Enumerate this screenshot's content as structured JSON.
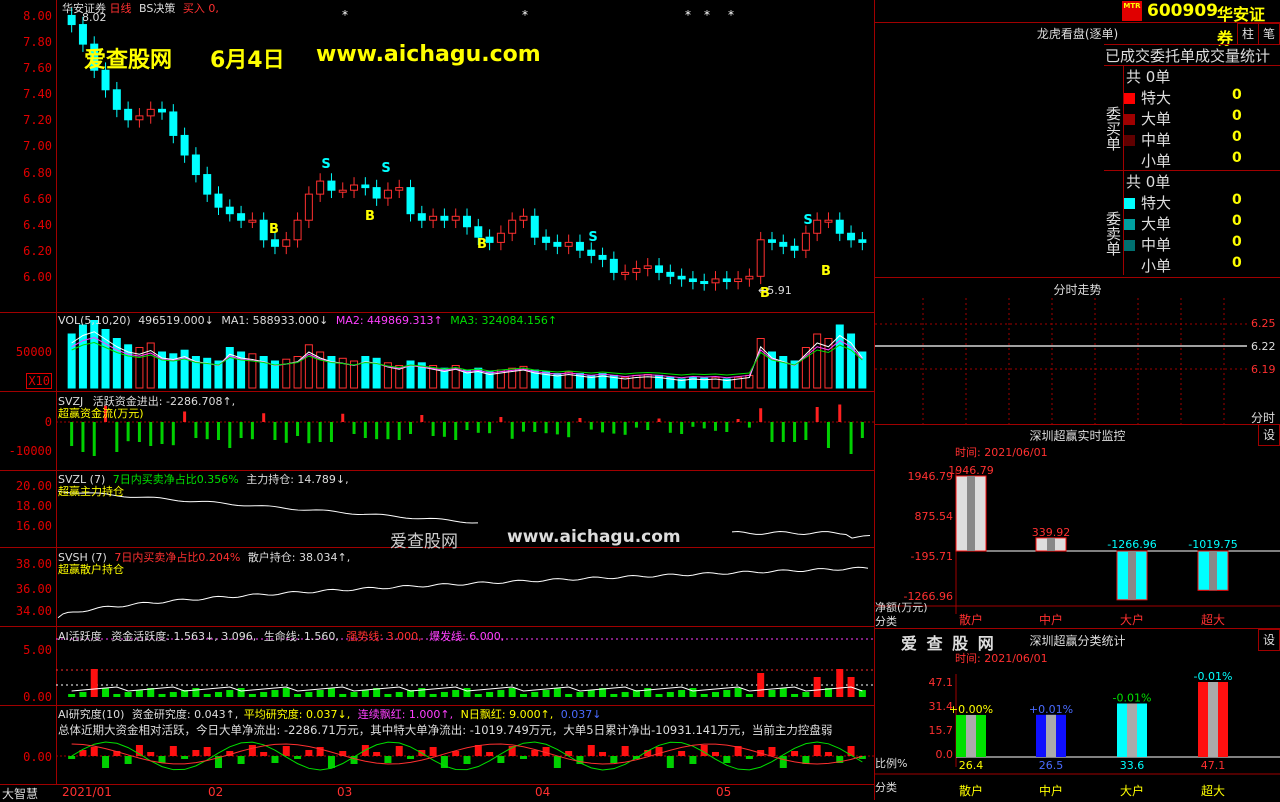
{
  "stock": {
    "code": "600909",
    "name": "华安证券",
    "badge": "MTR"
  },
  "chart_header": {
    "name": "华安证券",
    "period": "日线",
    "strategy": "BS决策",
    "buy": "买入",
    "buy_val": "0,"
  },
  "watermark1": {
    "site": "爱查股网",
    "date": "6月4日",
    "url": "www.aichagu.com"
  },
  "watermark2": {
    "site": "爱查股网",
    "url": "www.aichagu.com"
  },
  "price_axis": [
    "8.00",
    "7.80",
    "7.60",
    "7.40",
    "7.20",
    "7.00",
    "6.80",
    "6.60",
    "6.40",
    "6.20",
    "6.00"
  ],
  "price_labels": {
    "high": "8.02",
    "low": "5.91"
  },
  "vol": {
    "line": "VOL(5,10,20)",
    "v": "496519.000↓",
    "ma1": "MA1: 588933.000↓",
    "ma2": "MA2: 449869.313↑",
    "ma3": "MA3: 324084.156↑",
    "tick": "50000",
    "mult": "X10"
  },
  "svzj": {
    "name": "SVZJ",
    "label": "活跃资金进出: -2286.708↑,",
    "sub": "超赢资金流(万元)",
    "ticks": [
      "0",
      "-10000"
    ]
  },
  "svzl": {
    "name": "SVZL",
    "p": "(7)",
    "desc": "7日内买卖净占比0.356%",
    "hold": "主力持仓: 14.789↓,",
    "sub": "超赢主力持仓",
    "ticks": [
      "20.00",
      "18.00",
      "16.00"
    ]
  },
  "svsh": {
    "name": "SVSH",
    "p": "(7)",
    "desc": "7日内买卖净占比0.204%",
    "hold": "散户持仓: 38.034↑,",
    "sub": "超赢散户持仓",
    "ticks": [
      "38.00",
      "36.00",
      "34.00"
    ]
  },
  "ai_active": {
    "name": "AI活跃度",
    "a": "资金活跃度: 1.563↓,",
    "b": "3.096,",
    "c": "生命线: 1.560,",
    "d": "强势线: 3.000,",
    "e": "爆发线: 6.000,",
    "ticks": [
      "5.00",
      "0.00"
    ]
  },
  "ai_research": {
    "name": "AI研究度",
    "p": "(10)",
    "a": "资金研究度: 0.043↑,",
    "b": "平均研究度: 0.037↓,",
    "c": "连续飘红: 1.000↑,",
    "d": "N日飘红: 9.000↑,",
    "e": "0.037↓",
    "summary": "总体近期大资金相对活跃，今日大单净流出: -2286.71万元，其中特大单净流出: -1019.749万元，大单5日累计净出-10931.141万元，当前主力控盘弱",
    "tick": "0.00"
  },
  "xaxis": {
    "brand": "大智慧",
    "labels": [
      "2021/01",
      "02",
      "03",
      "04",
      "05"
    ]
  },
  "lhb": {
    "title": "龙虎看盘(逐单)",
    "btn1": "柱",
    "btn2": "笔",
    "sub": "已成交委托单成交量统计",
    "buy": {
      "side": "委买单",
      "total_label": "共",
      "total": "0单",
      "rows": [
        {
          "label": "特大",
          "val": "0",
          "color": "#ff0000"
        },
        {
          "label": "大单",
          "val": "0",
          "color": "#a00000"
        },
        {
          "label": "中单",
          "val": "0",
          "color": "#600000"
        },
        {
          "label": "小单",
          "val": "0",
          "color": "#000"
        }
      ]
    },
    "sell": {
      "side": "委卖单",
      "total_label": "共",
      "total": "0单",
      "rows": [
        {
          "label": "特大",
          "val": "0",
          "color": "#00ffff"
        },
        {
          "label": "大单",
          "val": "0",
          "color": "#00a0a0"
        },
        {
          "label": "中单",
          "val": "0",
          "color": "#007070"
        },
        {
          "label": "小单",
          "val": "0",
          "color": "#000"
        }
      ]
    }
  },
  "fenshi": {
    "title": "分时走势",
    "ticks": [
      "6.25",
      "6.22",
      "6.19"
    ],
    "xlabel": "分时"
  },
  "realtime": {
    "title": "深圳超赢实时监控",
    "btn": "设",
    "time": "时间: 2021/06/01",
    "ylabel": "净额(万元)",
    "xlabel": "分类",
    "ticks": [
      "1946.79",
      "875.54",
      "-195.71",
      "-1266.96"
    ],
    "bars": [
      {
        "cat": "散户",
        "val": "1946.79"
      },
      {
        "cat": "中户",
        "val": "339.92"
      },
      {
        "cat": "大户",
        "val": "-1266.96"
      },
      {
        "cat": "超大",
        "val": "-1019.75"
      }
    ]
  },
  "classify": {
    "title": "深圳超赢分类统计",
    "btn": "设",
    "site": "爱 查 股 网",
    "time": "时间: 2021/06/01",
    "ylabel": "比例%",
    "xlabel": "分类",
    "ticks": [
      "47.1",
      "31.4",
      "15.7",
      "0.0"
    ],
    "bars": [
      {
        "cat": "散户",
        "val": "26.4",
        "delta": "+0.00%",
        "color": "#00e000"
      },
      {
        "cat": "中户",
        "val": "26.5",
        "delta": "+0.01%",
        "color": "#1010ff"
      },
      {
        "cat": "大户",
        "val": "33.6",
        "delta": "-0.01%",
        "color": "#00ffff"
      },
      {
        "cat": "超大",
        "val": "47.1",
        "delta": "-0.01%",
        "color": "#ff1010"
      }
    ]
  },
  "chart_data": {
    "type": "candlestick",
    "title": "华安证券 日线",
    "ylim": [
      5.8,
      8.1
    ],
    "x_labels": [
      "2021/01",
      "02",
      "03",
      "04",
      "05"
    ],
    "ohlc_approx_closes": [
      7.95,
      7.8,
      7.6,
      7.45,
      7.3,
      7.22,
      7.25,
      7.3,
      7.28,
      7.1,
      6.95,
      6.8,
      6.65,
      6.55,
      6.5,
      6.45,
      6.45,
      6.3,
      6.25,
      6.3,
      6.45,
      6.65,
      6.75,
      6.68,
      6.68,
      6.72,
      6.7,
      6.62,
      6.68,
      6.7,
      6.5,
      6.45,
      6.48,
      6.45,
      6.48,
      6.4,
      6.32,
      6.28,
      6.35,
      6.45,
      6.48,
      6.32,
      6.28,
      6.25,
      6.28,
      6.22,
      6.18,
      6.15,
      6.05,
      6.05,
      6.08,
      6.1,
      6.05,
      6.02,
      6.0,
      5.98,
      5.97,
      6.0,
      5.98,
      6.0,
      6.02,
      6.3,
      6.28,
      6.25,
      6.22,
      6.35,
      6.45,
      6.45,
      6.35,
      6.3,
      6.28
    ]
  }
}
